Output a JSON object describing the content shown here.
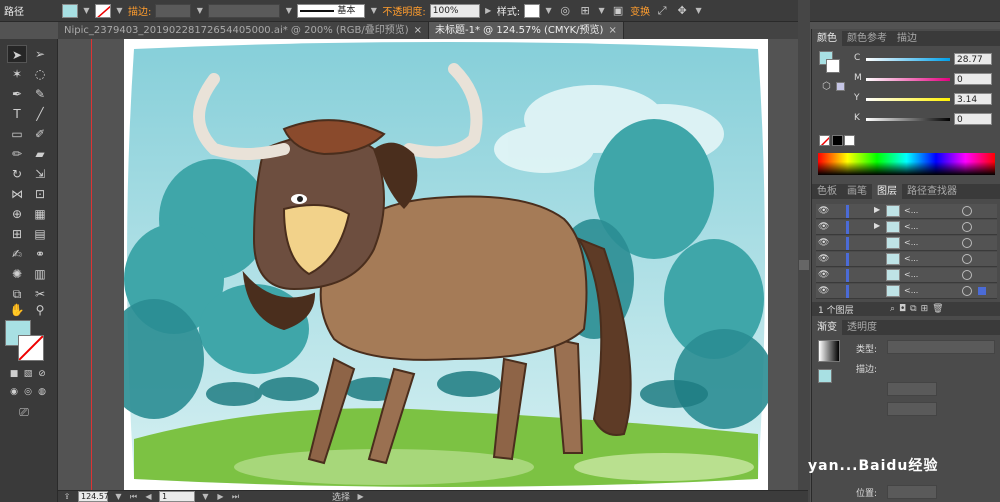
{
  "control_bar": {
    "path_label": "路径",
    "fill_color": "#a8e0e3",
    "stroke_label": "描边:",
    "stroke_style_label": "基本",
    "opacity_label": "不透明度:",
    "opacity_value": "100%",
    "style_label": "样式:",
    "transform_label": "变换"
  },
  "tabs": [
    {
      "label": "Nipic_2379403_20190228172654405000.ai* @ 200% (RGB/叠印预览)",
      "active": false
    },
    {
      "label": "未标题-1* @ 124.57% (CMYK/预览)",
      "active": true
    }
  ],
  "tab_close": "×",
  "status": {
    "zoom_value": "124.57",
    "artboard_value": "1",
    "tool_label": "选择"
  },
  "color_panel": {
    "tabs": [
      "颜色",
      "颜色参考",
      "描边"
    ],
    "channels": [
      {
        "label": "C",
        "value": "28.77",
        "track": "linear-gradient(90deg,#fff,#00a0e9)"
      },
      {
        "label": "M",
        "value": "0",
        "track": "linear-gradient(90deg,#fff,#e4007f)"
      },
      {
        "label": "Y",
        "value": "3.14",
        "track": "linear-gradient(90deg,#fff,#fff100)"
      },
      {
        "label": "K",
        "value": "0",
        "track": "linear-gradient(90deg,#fff,#000)"
      }
    ]
  },
  "layers_panel": {
    "tabs": [
      "色板",
      "画笔",
      "图层",
      "路径查找器"
    ],
    "footer_label": "1 个图层",
    "rows": [
      {
        "name": "<..."
      },
      {
        "name": "<..."
      },
      {
        "name": "<..."
      },
      {
        "name": "<..."
      },
      {
        "name": "<..."
      },
      {
        "name": "<..."
      }
    ]
  },
  "gradient_panel": {
    "tabs": [
      "渐变",
      "透明度"
    ],
    "type_label": "类型:",
    "stroke_label": "描边:",
    "position_label": "位置:"
  },
  "watermark": "yan...Baidu经验"
}
